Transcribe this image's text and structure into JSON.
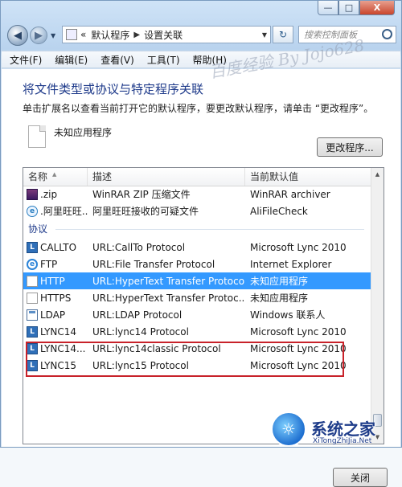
{
  "window": {
    "caption_buttons": [
      "—",
      "□",
      "X"
    ]
  },
  "address_bar": {
    "prefix": "«",
    "crumbs": [
      "默认程序",
      "设置关联"
    ],
    "search_placeholder": "搜索控制面板"
  },
  "menu": {
    "items": [
      "文件(F)",
      "编辑(E)",
      "查看(V)",
      "工具(T)",
      "帮助(H)"
    ]
  },
  "watermark": "百度经验 By Jojo628",
  "page": {
    "heading": "将文件类型或协议与特定程序关联",
    "subtitle": "单击扩展名以查看当前打开它的默认程序，要更改默认程序，请单击 “更改程序”。",
    "current_file": "未知应用程序",
    "change_button": "更改程序..."
  },
  "table": {
    "headers": [
      "名称",
      "描述",
      "当前默认值"
    ],
    "rows_before_group": [
      {
        "icon": "winrar-icon",
        "name": ".zip",
        "desc": "WinRAR ZIP 压缩文件",
        "default": "WinRAR archiver"
      },
      {
        "icon": "aliwangwang-icon",
        "name": ".阿里旺旺...",
        "desc": "阿里旺旺接收的可疑文件",
        "default": "AliFileCheck"
      }
    ],
    "group_label": "协议",
    "rows_after_group": [
      {
        "icon": "lync-icon",
        "name": "CALLTO",
        "desc": "URL:CallTo Protocol",
        "default": "Microsoft Lync 2010"
      },
      {
        "icon": "internet-explorer-icon",
        "name": "FTP",
        "desc": "URL:File Transfer Protocol",
        "default": "Internet Explorer"
      },
      {
        "icon": "blank-file-icon",
        "name": "HTTP",
        "desc": "URL:HyperText Transfer Protocol",
        "default": "未知应用程序",
        "selected": true
      },
      {
        "icon": "blank-file-icon",
        "name": "HTTPS",
        "desc": "URL:HyperText Transfer Protoc...",
        "default": "未知应用程序"
      },
      {
        "icon": "app-icon",
        "name": "LDAP",
        "desc": "URL:LDAP Protocol",
        "default": "Windows 联系人"
      },
      {
        "icon": "lync-icon",
        "name": "LYNC14",
        "desc": "URL:lync14 Protocol",
        "default": "Microsoft Lync 2010"
      },
      {
        "icon": "lync-icon",
        "name": "LYNC14...",
        "desc": "URL:lync14classic Protocol",
        "default": "Microsoft Lync 2010"
      },
      {
        "icon": "lync-icon",
        "name": "LYNC15",
        "desc": "URL:lync15 Protocol",
        "default": "Microsoft Lync 2010"
      }
    ]
  },
  "close_button": "关闭",
  "logo": {
    "text": "系统之家",
    "sub": "XiTongZhiJia.Net"
  },
  "colors": {
    "selection": "#3399ff",
    "highlight_box": "#c8222a",
    "heading": "#1e3a8a"
  }
}
